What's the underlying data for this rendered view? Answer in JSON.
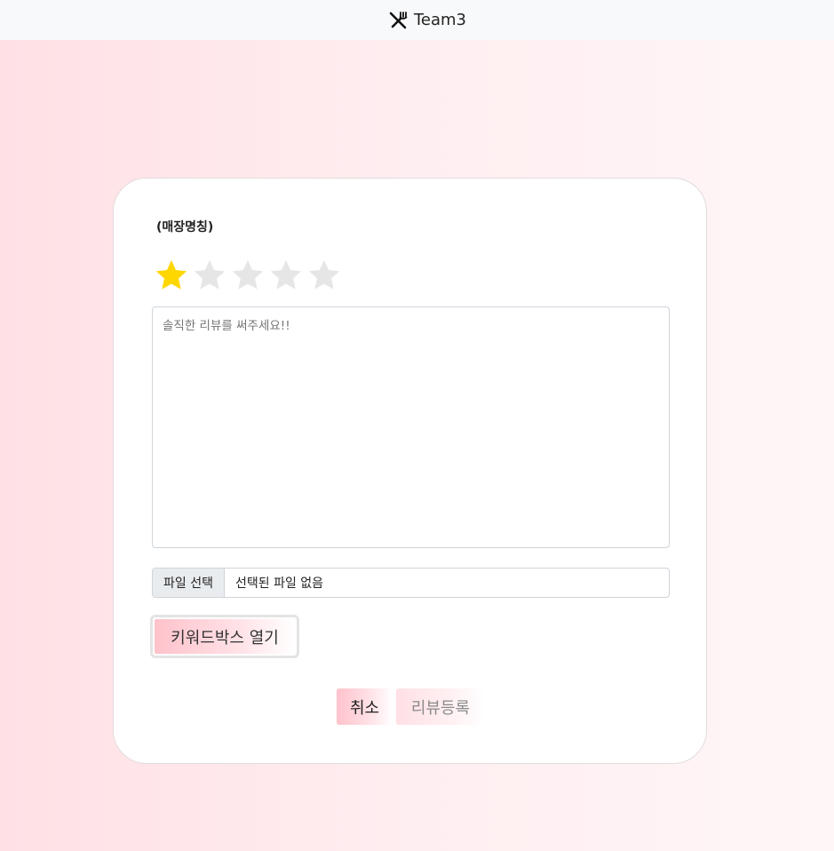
{
  "navbar": {
    "brand_icon": "utensils-crossed-icon",
    "brand_label": "Team3"
  },
  "review_form": {
    "store_name": "(매장명칭)",
    "rating": {
      "value": 1,
      "max": 5,
      "filled_color": "#FFD700",
      "empty_color": "#E6E6E6",
      "icon": "star-icon"
    },
    "review_text": {
      "value": "",
      "placeholder": "솔직한 리뷰를 써주세요!!"
    },
    "file_input": {
      "button_label": "파일 선택",
      "status_text": "선택된 파일 없음"
    },
    "keyword_button_label": "키워드박스 열기",
    "cancel_label": "취소",
    "submit_label": "리뷰등록"
  },
  "colors": {
    "accent_pink": "#FFC2CB",
    "background_pink": "#FFE0E5"
  }
}
